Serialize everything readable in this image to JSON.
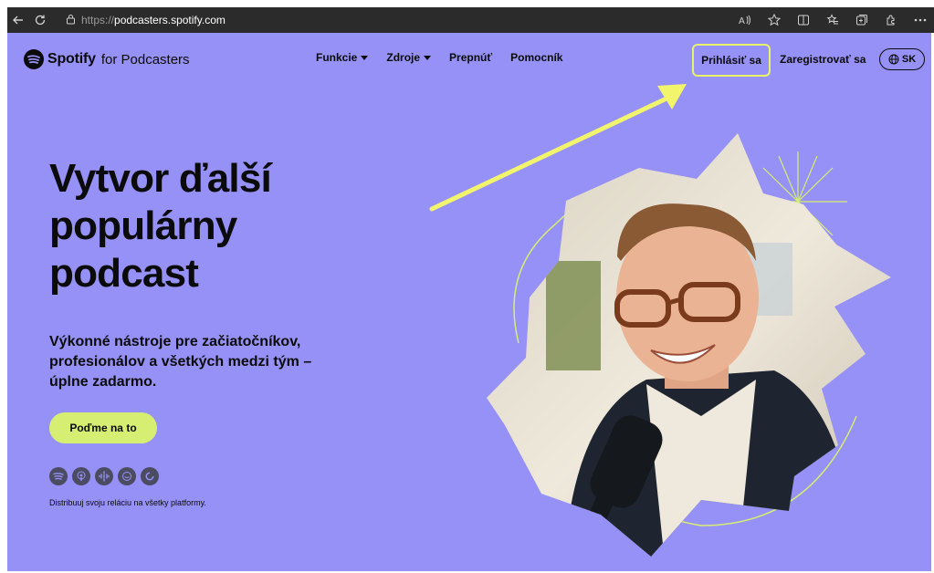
{
  "browser": {
    "url_protocol": "https://",
    "url_host": "podcasters.spotify.com",
    "icons": [
      "back-arrow-icon",
      "refresh-icon",
      "lock-icon",
      "read-aloud-icon",
      "star-icon",
      "split-view-icon",
      "favorites-icon",
      "collections-icon",
      "extensions-icon",
      "more-icon"
    ]
  },
  "nav": {
    "logo_brand": "Spotify",
    "logo_suffix": "for Podcasters",
    "menu": [
      {
        "label": "Funkcie",
        "has_dropdown": true
      },
      {
        "label": "Zdroje",
        "has_dropdown": true
      },
      {
        "label": "Prepnúť",
        "has_dropdown": false
      },
      {
        "label": "Pomocník",
        "has_dropdown": false
      }
    ],
    "login": "Prihlásiť sa",
    "signup": "Zaregistrovať sa",
    "language": "SK"
  },
  "hero": {
    "headline": [
      "Vytvor ďalší",
      "populárny",
      "podcast"
    ],
    "subtitle": [
      "Výkonné nástroje pre začiatočníkov,",
      "profesionálov a všetkých medzi tým –",
      "úplne zadarmo."
    ],
    "cta": "Poďme na to",
    "platform_icons": [
      "spotify-icon",
      "apple-podcasts-icon",
      "google-podcasts-icon",
      "amazon-music-icon",
      "pocket-casts-icon"
    ],
    "platforms_text": "Distribuuj svoju reláciu na všetky platformy."
  },
  "colors": {
    "background": "#9691f6",
    "accent_lime": "#d6ef72",
    "highlight_yellow": "#e9f36a",
    "text": "#0b0b0b",
    "browser_bar": "#2b2b2b"
  }
}
